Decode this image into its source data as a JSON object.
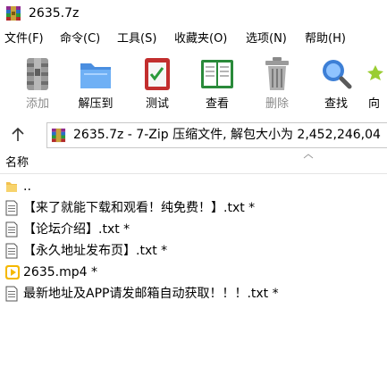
{
  "window": {
    "title": "2635.7z",
    "icon": "winrar-archive-icon"
  },
  "menu": [
    {
      "label": "文件(F)"
    },
    {
      "label": "命令(C)"
    },
    {
      "label": "工具(S)"
    },
    {
      "label": "收藏夹(O)"
    },
    {
      "label": "选项(N)"
    },
    {
      "label": "帮助(H)"
    }
  ],
  "toolbar": [
    {
      "label": "添加",
      "icon": "add-archive-icon",
      "enabled": false
    },
    {
      "label": "解压到",
      "icon": "extract-folder-icon",
      "enabled": true
    },
    {
      "label": "测试",
      "icon": "test-checklist-icon",
      "enabled": true
    },
    {
      "label": "查看",
      "icon": "view-book-icon",
      "enabled": true
    },
    {
      "label": "删除",
      "icon": "trash-icon",
      "enabled": false
    },
    {
      "label": "查找",
      "icon": "magnifier-icon",
      "enabled": true
    },
    {
      "label": "向",
      "icon": "wizard-icon",
      "enabled": true
    }
  ],
  "address": {
    "text": "2635.7z - 7-Zip 压缩文件, 解包大小为 2,452,246,04"
  },
  "columns": {
    "name": "名称"
  },
  "files": [
    {
      "name": "..",
      "type": "folder"
    },
    {
      "name": "【来了就能下载和观看！纯免费！】.txt *",
      "type": "text"
    },
    {
      "name": "【论坛介绍】.txt *",
      "type": "text"
    },
    {
      "name": "【永久地址发布页】.txt *",
      "type": "text"
    },
    {
      "name": "2635.mp4 *",
      "type": "video"
    },
    {
      "name": "最新地址及APP请发邮箱自动获取！！！.txt *",
      "type": "text"
    }
  ],
  "colors": {
    "accent": "#1c74d4",
    "disabled_text": "#8a8a8a",
    "folder": "#f2c14e",
    "video": "#f5b800"
  }
}
